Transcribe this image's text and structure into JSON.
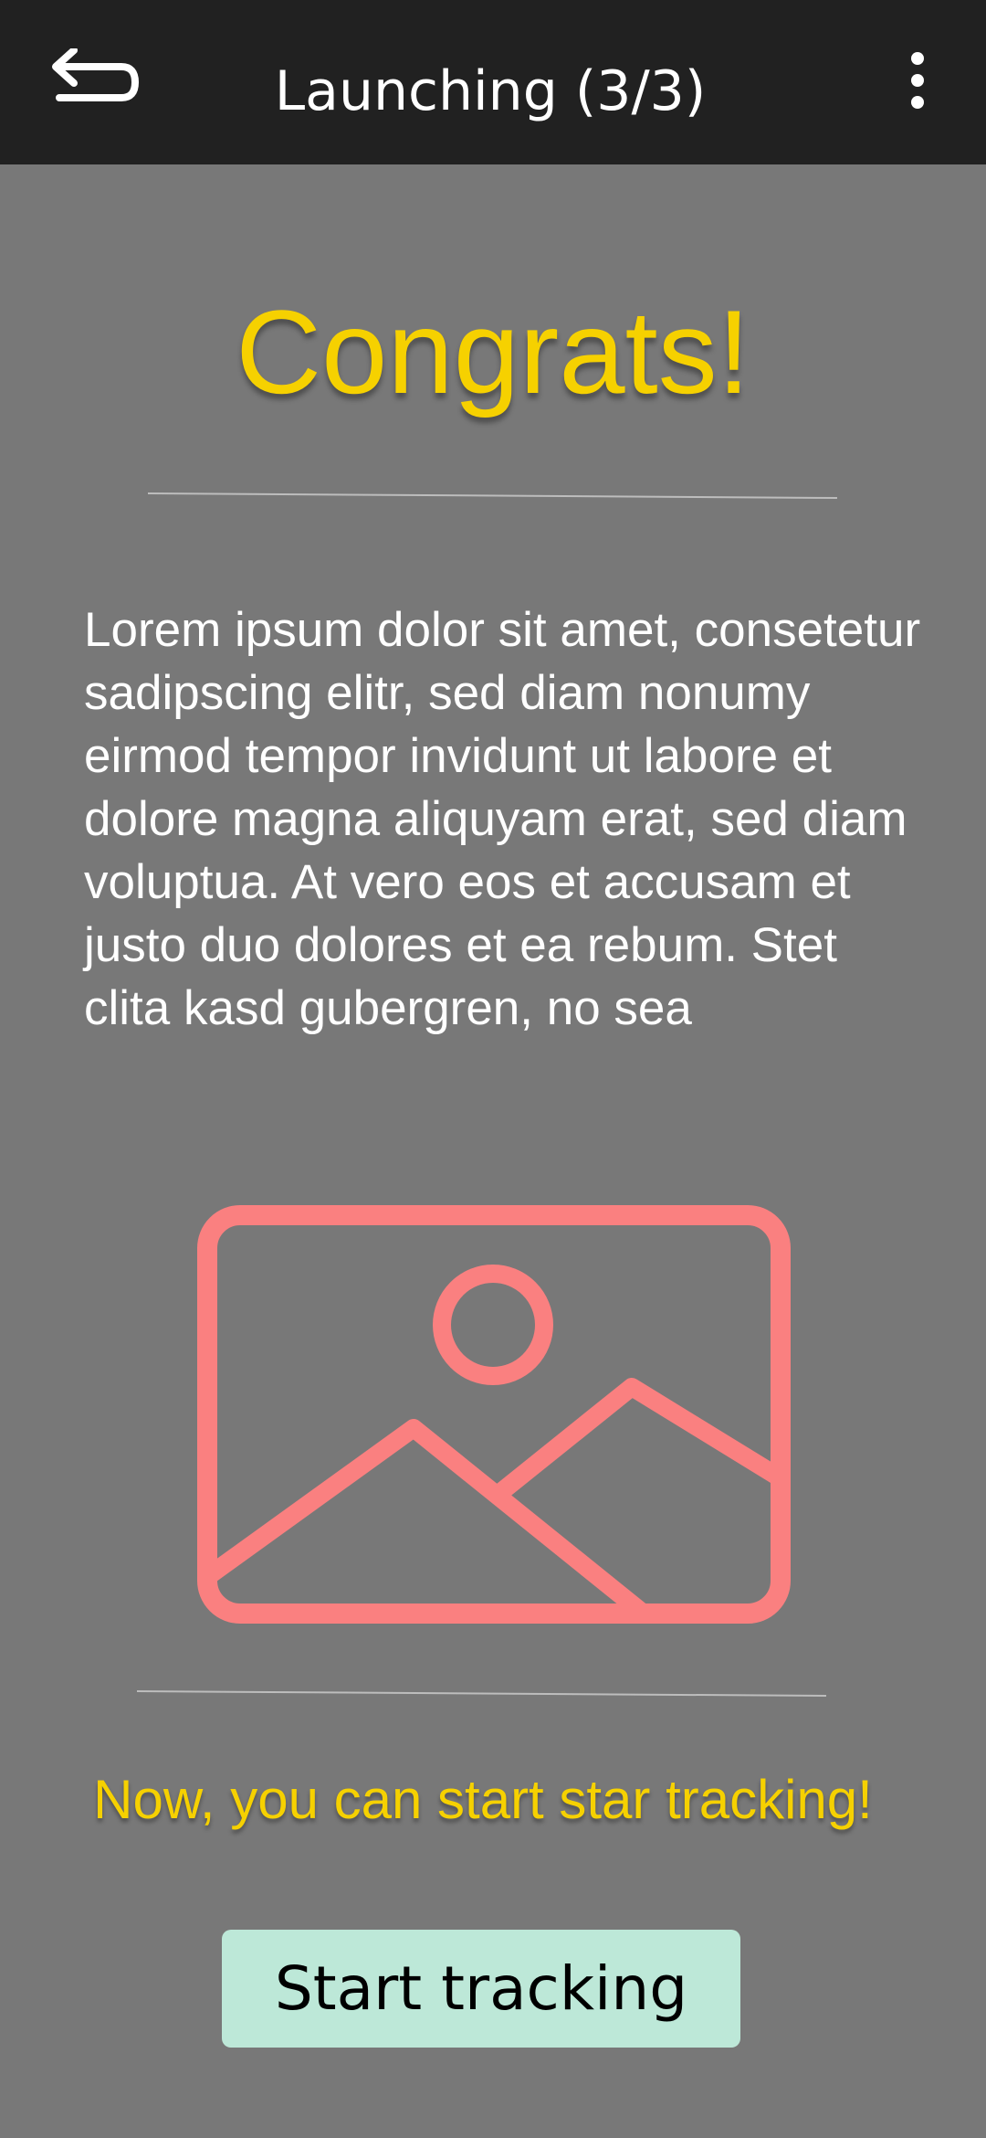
{
  "app_bar": {
    "title": "Launching (3/3)",
    "back_icon": "back-arrow-icon",
    "menu_icon": "more-vertical-icon"
  },
  "content": {
    "headline": "Congrats!",
    "body": "Lorem ipsum dolor sit amet, consetetur sadipscing elitr, sed diam nonumy eirmod tempor invidunt ut labore et dolore magna aliquyam erat, sed diam voluptua. At vero eos et accusam et justo duo dolores et ea rebum. Stet clita kasd gubergren, no sea",
    "image_icon": "image-placeholder-icon",
    "cta_text": "Now, you can start star tracking!",
    "start_button_label": "Start tracking"
  },
  "colors": {
    "app_bar_bg": "#212121",
    "page_bg": "#787878",
    "accent_yellow": "#f6d100",
    "image_icon_color": "#fa8080",
    "button_bg": "#bde8d8"
  }
}
